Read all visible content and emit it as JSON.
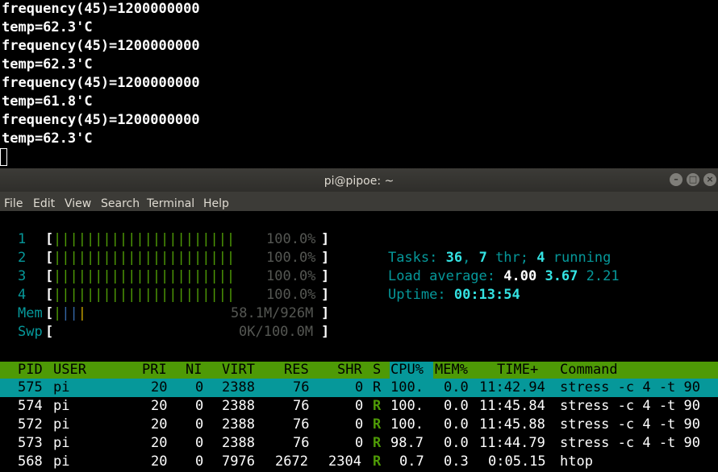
{
  "background_terminal": {
    "lines": [
      "frequency(45)=1200000000",
      "temp=62.3'C",
      "frequency(45)=1200000000",
      "temp=62.3'C",
      "frequency(45)=1200000000",
      "temp=61.8'C",
      "frequency(45)=1200000000",
      "temp=62.3'C"
    ]
  },
  "window": {
    "title": "pi@pipoe: ~",
    "menu": [
      "File",
      "Edit",
      "View",
      "Search",
      "Terminal",
      "Help"
    ]
  },
  "meters": {
    "cpus": [
      {
        "num": "1",
        "bars": "||||||||||||||||||||||",
        "pct": "100.0%",
        "level": 1.0
      },
      {
        "num": "2",
        "bars": "||||||||||||||||||||||",
        "pct": "100.0%",
        "level": 1.0
      },
      {
        "num": "3",
        "bars": "||||||||||||||||||||||",
        "pct": "100.0%",
        "level": 1.0
      },
      {
        "num": "4",
        "bars": "||||||||||||||||||||||",
        "pct": "100.0%",
        "level": 1.0
      }
    ],
    "mem": {
      "label": "Mem",
      "bars": "||||",
      "value": "58.1M/926M"
    },
    "swp": {
      "label": "Swp",
      "bars": "",
      "value": "0K/100.0M"
    },
    "open_bracket": "[",
    "close_bracket": "]"
  },
  "summary": {
    "tasks_label": "Tasks: ",
    "tasks": "36",
    "sep1": ", ",
    "threads": "7",
    "thr_label": " thr; ",
    "running": "4",
    "running_label": " running",
    "load_label": "Load average: ",
    "load1": "4.00",
    "load5": "3.67",
    "load15": "2.21",
    "uptime_label": "Uptime: ",
    "uptime": "00:13:54"
  },
  "table": {
    "headers": {
      "pid": "PID",
      "user": "USER",
      "pri": "PRI",
      "ni": "NI",
      "virt": "VIRT",
      "res": "RES",
      "shr": "SHR",
      "s": "S",
      "cpu": "CPU%",
      "mem": "MEM%",
      "time": "TIME+",
      "command": "Command"
    },
    "rows": [
      {
        "pid": "575",
        "user": "pi",
        "pri": "20",
        "ni": "0",
        "virt": "2388",
        "res": "76",
        "shr": "0",
        "s": "R",
        "cpu": "100.",
        "mem": "0.0",
        "time": "11:42.94",
        "command": "stress -c 4 -t 90"
      },
      {
        "pid": "574",
        "user": "pi",
        "pri": "20",
        "ni": "0",
        "virt": "2388",
        "res": "76",
        "shr": "0",
        "s": "R",
        "cpu": "100.",
        "mem": "0.0",
        "time": "11:45.84",
        "command": "stress -c 4 -t 90"
      },
      {
        "pid": "572",
        "user": "pi",
        "pri": "20",
        "ni": "0",
        "virt": "2388",
        "res": "76",
        "shr": "0",
        "s": "R",
        "cpu": "100.",
        "mem": "0.0",
        "time": "11:45.88",
        "command": "stress -c 4 -t 90"
      },
      {
        "pid": "573",
        "user": "pi",
        "pri": "20",
        "ni": "0",
        "virt": "2388",
        "res": "76",
        "shr": "0",
        "s": "R",
        "cpu": "98.7",
        "mem": "0.0",
        "time": "11:44.79",
        "command": "stress -c 4 -t 90"
      },
      {
        "pid": "568",
        "user": "pi",
        "pri": "20",
        "ni": "0",
        "virt": "7976",
        "res": "2672",
        "shr": "2304",
        "s": "R",
        "cpu": "0.7",
        "mem": "0.3",
        "time": "0:05.15",
        "command": "htop"
      }
    ]
  },
  "colors": {
    "header_bg": "#4e9a06",
    "selected_bg": "#06989a",
    "meter_bar": "#4e9a06",
    "label_cyan": "#06989a",
    "value_bright_cyan": "#34e2e2"
  }
}
